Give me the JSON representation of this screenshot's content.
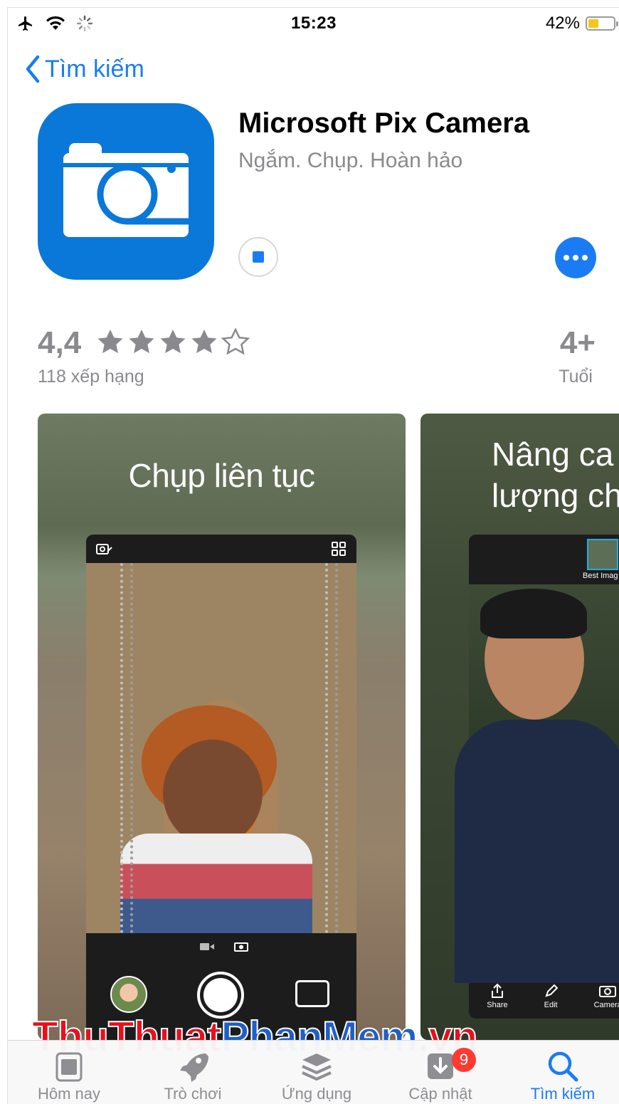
{
  "status_bar": {
    "time": "15:23",
    "battery": "42%",
    "battery_level": 0.42,
    "icons": [
      "airplane-icon",
      "wifi-icon",
      "activity-spinner-icon"
    ]
  },
  "nav": {
    "back_label": "Tìm kiếm"
  },
  "app": {
    "title": "Microsoft Pix Camera",
    "subtitle": "Ngắm. Chụp. Hoàn hảo",
    "icon": "camera-icon",
    "brand_color": "#0a78d8"
  },
  "rating": {
    "value": "4,4",
    "stars": 4.4,
    "count_label": "118 xếp hạng",
    "age": "4+",
    "age_label": "Tuổi"
  },
  "screenshots": [
    {
      "caption": "Chụp liên tục"
    },
    {
      "caption": "Nâng ca\nlượng ch",
      "best_label": "Best Imag",
      "tools": [
        "Share",
        "Edit",
        "Camera"
      ]
    }
  ],
  "watermark": {
    "part1": "ThuThuat",
    "part2": "PhanMem",
    "part3": ".vn"
  },
  "tabs": [
    {
      "label": "Hôm nay",
      "icon": "today-icon"
    },
    {
      "label": "Trò chơi",
      "icon": "rocket-icon"
    },
    {
      "label": "Ứng dụng",
      "icon": "layers-icon"
    },
    {
      "label": "Cập nhật",
      "icon": "download-icon",
      "badge": "9"
    },
    {
      "label": "Tìm kiếm",
      "icon": "search-icon",
      "active": true
    }
  ],
  "colors": {
    "accent": "#1a7cf5",
    "badge": "#ff3b30",
    "secondary_text": "#8a8a8e"
  }
}
